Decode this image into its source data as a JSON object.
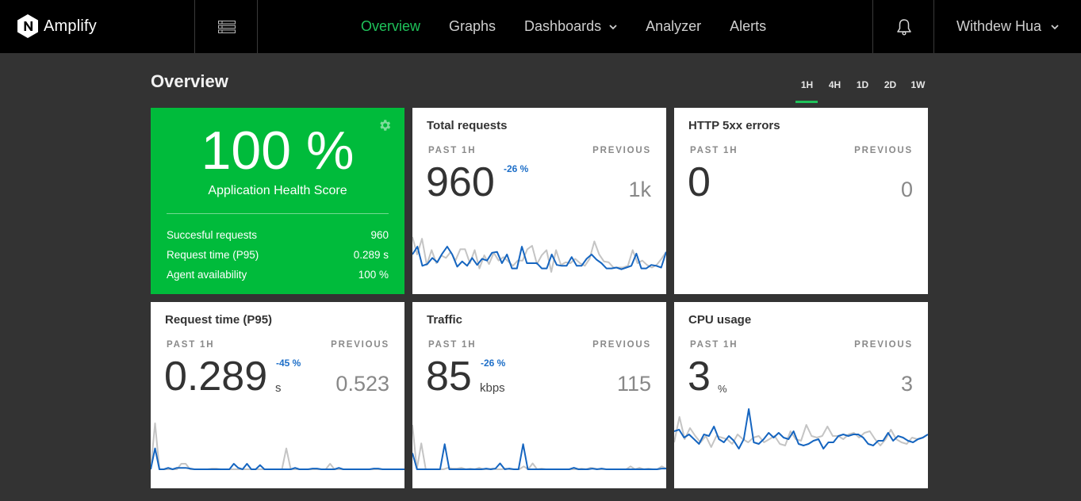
{
  "app": {
    "brand": "Amplify",
    "logo_letter": "N"
  },
  "nav": {
    "items": [
      {
        "label": "Overview",
        "active": true
      },
      {
        "label": "Graphs",
        "active": false
      },
      {
        "label": "Dashboards",
        "active": false,
        "has_dropdown": true
      },
      {
        "label": "Analyzer",
        "active": false
      },
      {
        "label": "Alerts",
        "active": false
      }
    ],
    "menu_icon": "list-menu-icon",
    "notifications_icon": "bell-icon",
    "user_name": "Withdew Hua"
  },
  "page": {
    "title": "Overview",
    "ranges": [
      {
        "label": "1H",
        "active": true
      },
      {
        "label": "4H",
        "active": false
      },
      {
        "label": "1D",
        "active": false
      },
      {
        "label": "2D",
        "active": false
      },
      {
        "label": "1W",
        "active": false
      }
    ]
  },
  "colors": {
    "accent": "#1fc25a",
    "health_bg": "#00bb3b",
    "current_series": "#1565c0",
    "previous_series": "#c4c4c4",
    "delta": "#1e6fc8"
  },
  "health": {
    "score": "100 %",
    "label": "Application Health Score",
    "settings_icon": "gear-icon",
    "rows": [
      {
        "label": "Succesful requests",
        "value": "960"
      },
      {
        "label": "Request time (P95)",
        "value": "0.289 s"
      },
      {
        "label": "Agent availability",
        "value": "100 %"
      }
    ]
  },
  "cards": [
    {
      "title": "Total requests",
      "period_label": "PAST 1H",
      "previous_label": "PREVIOUS",
      "value": "960",
      "delta": "-26 %",
      "unit": "",
      "previous": "1k",
      "current_series": [
        40,
        58,
        14,
        18,
        32,
        22,
        42,
        58,
        40,
        12,
        24,
        14,
        32,
        16,
        30,
        26,
        44,
        46,
        20,
        40,
        8,
        8,
        58,
        20,
        20,
        20,
        8,
        8,
        40,
        16,
        14,
        14,
        34,
        14,
        14,
        30,
        40,
        28,
        20,
        8,
        8,
        10,
        6,
        10,
        14,
        42,
        8,
        8,
        16,
        14,
        10,
        46
      ],
      "previous_series": [
        80,
        40,
        76,
        16,
        50,
        20,
        38,
        32,
        46,
        26,
        52,
        52,
        20,
        50,
        8,
        38,
        18,
        44,
        26,
        34,
        24,
        14,
        26,
        26,
        52,
        60,
        18,
        38,
        50,
        0,
        50,
        16,
        22,
        20,
        30,
        20,
        14,
        30,
        70,
        40,
        24,
        22,
        10,
        10,
        10,
        14,
        50,
        20,
        26,
        16,
        10,
        16,
        30,
        46
      ]
    },
    {
      "title": "HTTP 5xx errors",
      "period_label": "PAST 1H",
      "previous_label": "PREVIOUS",
      "value": "0",
      "delta": "",
      "unit": "",
      "previous": "0",
      "current_series": [],
      "previous_series": []
    },
    {
      "title": "Request time (P95)",
      "period_label": "PAST 1H",
      "previous_label": "PREVIOUS",
      "value": "0.289",
      "delta": "-45 %",
      "unit": "s",
      "previous": "0.523",
      "current_series": [
        0,
        30,
        0,
        0,
        2,
        0,
        2,
        2,
        2,
        1,
        0,
        0,
        0,
        0,
        0,
        0,
        0,
        0,
        0,
        8,
        2,
        0,
        8,
        0,
        0,
        6,
        0,
        0,
        0,
        0,
        0,
        0,
        0,
        2,
        0,
        0,
        0,
        1,
        1,
        0,
        0,
        0,
        0,
        2,
        0,
        0,
        0,
        0,
        0,
        0,
        0,
        1,
        1,
        0,
        0,
        0,
        0,
        0,
        0
      ],
      "previous_series": [
        0,
        66,
        0,
        0,
        0,
        0,
        0,
        8,
        8,
        0,
        0,
        0,
        0,
        0,
        1,
        1,
        0,
        0,
        0,
        0,
        0,
        0,
        0,
        0,
        0,
        0,
        0,
        0,
        0,
        0,
        0,
        30,
        0,
        0,
        0,
        0,
        0,
        0,
        0,
        0,
        0,
        8,
        0,
        0,
        0,
        0,
        0,
        0,
        0,
        0,
        0,
        0,
        0,
        0,
        0,
        0,
        0,
        0,
        0
      ]
    },
    {
      "title": "Traffic",
      "period_label": "PAST 1H",
      "previous_label": "PREVIOUS",
      "value": "85",
      "delta": "-26 %",
      "unit": "kbps",
      "previous": "115",
      "current_series": [
        22,
        0,
        0,
        0,
        0,
        0,
        0,
        34,
        0,
        0,
        0,
        0,
        0,
        0,
        0,
        0,
        1,
        0,
        1,
        8,
        0,
        1,
        0,
        0,
        34,
        0,
        0,
        0,
        0,
        0,
        0,
        0,
        0,
        0,
        0,
        2,
        0,
        0,
        0,
        1,
        0,
        1,
        0,
        0,
        0,
        0,
        0,
        0,
        0,
        0,
        0,
        0,
        0,
        0,
        1,
        1
      ],
      "previous_series": [
        60,
        0,
        35,
        0,
        0,
        0,
        0,
        0,
        2,
        1,
        1,
        2,
        0,
        1,
        0,
        2,
        0,
        0,
        1,
        0,
        0,
        1,
        0,
        0,
        0,
        4,
        0,
        8,
        0,
        1,
        0,
        0,
        0,
        0,
        0,
        0,
        0,
        0,
        1,
        0,
        2,
        1,
        0,
        0,
        0,
        0,
        0,
        0,
        0,
        4,
        0,
        2,
        0,
        1,
        0,
        0,
        4,
        1
      ]
    },
    {
      "title": "CPU usage",
      "period_label": "PAST 1H",
      "previous_label": "PREVIOUS",
      "value": "3",
      "delta": "",
      "unit": "%",
      "previous": "3",
      "current_series": [
        3.1,
        3.2,
        2.7,
        2.9,
        2.6,
        2.3,
        2.9,
        2.8,
        3.4,
        2.6,
        2.4,
        2.8,
        2.5,
        2.0,
        2.6,
        4.5,
        2.4,
        2.3,
        2.6,
        3.0,
        2.7,
        3.0,
        2.7,
        2.6,
        3.1,
        2.3,
        2.2,
        2.3,
        2.5,
        2.6,
        2.0,
        2.4,
        2.4,
        2.8,
        2.9,
        2.8,
        2.9,
        2.9,
        2.7,
        2.3,
        2.2,
        2.5,
        2.5,
        3.0,
        2.5,
        2.8,
        2.7,
        2.5,
        2.4,
        2.6,
        2.7,
        2.9
      ],
      "previous_series": [
        2.4,
        4.0,
        2.6,
        3.3,
        2.8,
        2.4,
        2.8,
        2.1,
        2.8,
        2.7,
        2.6,
        2.3,
        2.9,
        2.6,
        2.4,
        2.7,
        2.8,
        2.4,
        2.6,
        2.8,
        2.3,
        2.2,
        3.1,
        2.6,
        2.5,
        3.5,
        2.8,
        2.7,
        2.8,
        3.4,
        2.8,
        2.8,
        2.6,
        2.9,
        3.0,
        2.7,
        3.0,
        3.1,
        2.6,
        2.2,
        2.6,
        3.2,
        2.6,
        2.4,
        2.3,
        2.7,
        2.6,
        2.7,
        2.9
      ]
    }
  ]
}
